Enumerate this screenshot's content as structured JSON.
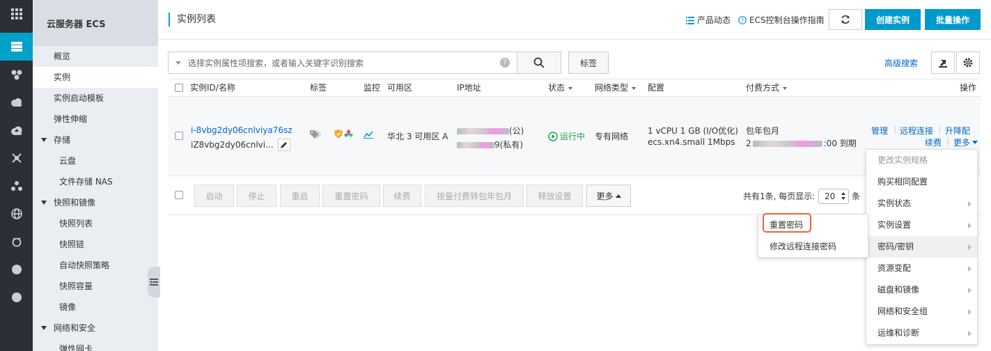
{
  "rail": {
    "icons": [
      "apps-icon",
      "server-icon",
      "cluster-icon",
      "cloud-icon",
      "cloud-upload-icon",
      "network-icon",
      "topology-icon",
      "globe-icon",
      "cdn-icon",
      "circle-icon",
      "circle-icon"
    ]
  },
  "sidebar": {
    "title": "云服务器 ECS",
    "items": [
      {
        "label": "概览"
      },
      {
        "label": "实例"
      },
      {
        "label": "实例启动模板"
      },
      {
        "label": "弹性伸缩"
      },
      {
        "label": "存储"
      },
      {
        "label": "云盘"
      },
      {
        "label": "文件存储 NAS"
      },
      {
        "label": "快照和镜像"
      },
      {
        "label": "快照列表"
      },
      {
        "label": "快照链"
      },
      {
        "label": "自动快照策略"
      },
      {
        "label": "快照容量"
      },
      {
        "label": "镜像"
      },
      {
        "label": "网络和安全"
      },
      {
        "label": "弹性网卡"
      }
    ]
  },
  "header": {
    "title": "实例列表",
    "product_news": "产品动态",
    "guide": "ECS控制台操作指南",
    "create_label": "创建实例",
    "batch_label": "批量操作"
  },
  "search": {
    "placeholder": "选择实例属性项搜索，或者输入关键字识别搜索",
    "help": "?",
    "tag_label": "标签",
    "advanced_label": "高级搜索"
  },
  "table": {
    "columns": [
      "实例ID/名称",
      "标签",
      "监控",
      "可用区",
      "IP地址",
      "状态",
      "网络类型",
      "配置",
      "付费方式",
      "操作"
    ],
    "row": {
      "instance_id": "i-8vbg2dy06cnlviya76sz",
      "instance_name": "iZ8vbg2dy06cnlvi...",
      "zone": "华北 3 可用区 A",
      "ip_public_suffix": "(公)",
      "ip_private_suffix": "9(私有)",
      "status": "运行中",
      "network": "专有网络",
      "config_line1": "1 vCPU 1 GB (I/O优化)",
      "config_line2": "ecs.xn4.small   1Mbps",
      "billing_type": "包年包月",
      "billing_expiry_prefix": "2",
      "billing_expiry_suffix": ":00 到期",
      "actions": {
        "manage": "管理",
        "remote": "远程连接",
        "upgrade": "升降配",
        "renew": "续费",
        "more": "更多"
      }
    }
  },
  "footer": {
    "buttons": [
      "启动",
      "停止",
      "重启",
      "重置密码",
      "续费",
      "按量付费转包年包月",
      "释放设置",
      "更多"
    ],
    "total_prefix": "共有1条, 每页显示:",
    "page_size": "20",
    "total_suffix": "条"
  },
  "more_menu": {
    "items": [
      {
        "label": "更改实例规格",
        "disabled": true,
        "submenu": false
      },
      {
        "label": "购买相同配置",
        "disabled": false,
        "submenu": false
      },
      {
        "label": "实例状态",
        "disabled": false,
        "submenu": true
      },
      {
        "label": "实例设置",
        "disabled": false,
        "submenu": true
      },
      {
        "label": "密码/密钥",
        "disabled": false,
        "submenu": true
      },
      {
        "label": "资源变配",
        "disabled": false,
        "submenu": true
      },
      {
        "label": "磁盘和镜像",
        "disabled": false,
        "submenu": true
      },
      {
        "label": "网络和安全组",
        "disabled": false,
        "submenu": true
      },
      {
        "label": "运维和诊断",
        "disabled": false,
        "submenu": true
      }
    ]
  },
  "password_submenu": {
    "items": [
      {
        "label": "重置密码"
      },
      {
        "label": "修改远程连接密码"
      }
    ]
  },
  "colors": {
    "accent": "#00a2ca",
    "primary_button": "#0099cc",
    "link": "#0066cc",
    "running": "#1aa04a",
    "highlight": "#f0623a"
  }
}
